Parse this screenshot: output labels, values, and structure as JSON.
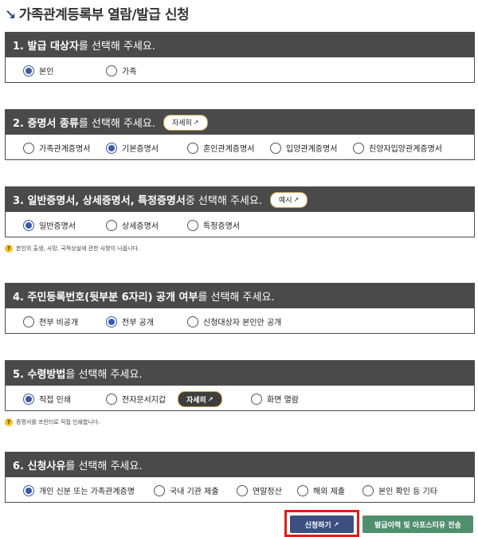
{
  "page": {
    "title": "가족관계등록부 열람/발급 신청",
    "title_icon": "arrow-icon"
  },
  "sections": [
    {
      "head_bold": "1. 발급 대상자",
      "head_rest": "를 선택해 주세요.",
      "options": [
        {
          "label": "본인",
          "checked": true
        },
        {
          "label": "가족",
          "checked": false
        }
      ]
    },
    {
      "head_bold": "2. 증명서 종류",
      "head_rest": "를 선택해 주세요.",
      "pill": "자세히",
      "options": [
        {
          "label": "가족관계증명서",
          "checked": false
        },
        {
          "label": "기본증명서",
          "checked": true
        },
        {
          "label": "혼인관계증명서",
          "checked": false
        },
        {
          "label": "입양관계증명서",
          "checked": false
        },
        {
          "label": "친양자입양관계증명서",
          "checked": false
        }
      ]
    },
    {
      "head_bold": "3. 일반증명서, 상세증명서, 특정증명서",
      "head_rest": " 중 선택해 주세요.",
      "pill": "예시",
      "options": [
        {
          "label": "일반증명서",
          "checked": true
        },
        {
          "label": "상세증명서",
          "checked": false
        },
        {
          "label": "특정증명서",
          "checked": false
        }
      ],
      "note": "본인의 출생, 사망, 국적상실에 관한 사항이 나옵니다."
    },
    {
      "head_bold": "4. 주민등록번호(뒷부분 6자리) 공개 여부",
      "head_rest": "를 선택해 주세요.",
      "options": [
        {
          "label": "전부 비공개",
          "checked": false
        },
        {
          "label": "전부 공개",
          "checked": true
        },
        {
          "label": "신청대상자 본인만 공개",
          "checked": false
        }
      ]
    },
    {
      "head_bold": "5. 수령방법",
      "head_rest": "을 선택해 주세요.",
      "inline_pill": "자세히",
      "options": [
        {
          "label": "직접 인쇄",
          "checked": true
        },
        {
          "label": "전자문서지갑",
          "checked": false
        },
        {
          "label": "화면 열람",
          "checked": false
        }
      ],
      "note": "증명서를 프린터로 직접 인쇄합니다."
    },
    {
      "head_bold": "6. 신청사유",
      "head_rest": "를 선택해 주세요.",
      "options": [
        {
          "label": "개인 신분 또는 가족관계증명",
          "checked": true
        },
        {
          "label": "국내 기관 제출",
          "checked": false
        },
        {
          "label": "연말정산",
          "checked": false
        },
        {
          "label": "해외 제출",
          "checked": false
        },
        {
          "label": "본인 확인 등 기타",
          "checked": false
        }
      ]
    }
  ],
  "external_mark": "↗",
  "note_icon": "?",
  "buttons": {
    "apply": "신청하기",
    "history": "발급이력 및 아포스티유 전송"
  },
  "colors": {
    "header_bg": "#4a4a4a",
    "radio_on": "#3a5aa8",
    "apply_bg": "#3c4f80",
    "history_bg": "#4f8f6e",
    "highlight": "#e01b1b",
    "pill_border": "#c9a24a"
  }
}
